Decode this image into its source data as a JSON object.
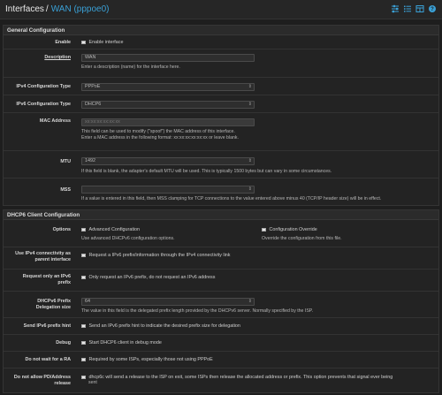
{
  "header": {
    "crumb_root": "Interfaces",
    "separator": "/",
    "crumb_current": "WAN (pppoe0)",
    "icons": [
      "sliders-icon",
      "list-icon",
      "table-icon",
      "help-icon"
    ]
  },
  "general": {
    "title": "General Configuration",
    "enable": {
      "label": "Enable",
      "text": "Enable interface"
    },
    "description": {
      "label": "Description",
      "value": "WAN",
      "help": "Enter a description (name) for the interface here."
    },
    "ipv4_type": {
      "label": "IPv4 Configuration Type",
      "value": "PPPoE"
    },
    "ipv6_type": {
      "label": "IPv6 Configuration Type",
      "value": "DHCP6"
    },
    "mac": {
      "label": "MAC Address",
      "placeholder": "xx:xx:xx:xx:xx:xx",
      "help1": "This field can be used to modify (\"spoof\") the MAC address of this interface.",
      "help2": "Enter a MAC address in the following format: xx:xx:xx:xx:xx:xx or leave blank."
    },
    "mtu": {
      "label": "MTU",
      "value": "1492",
      "help": "If this field is blank, the adapter's default MTU will be used. This is typically 1500 bytes but can vary in some circumstances."
    },
    "mss": {
      "label": "MSS",
      "value": "",
      "help": "If a value is entered in this field, then MSS clamping for TCP connections to the value entered above minus 40 (TCP/IP header size) will be in effect."
    }
  },
  "dhcp6": {
    "title": "DHCP6 Client Configuration",
    "options": {
      "label": "Options",
      "advanced": "Advanced Configuration",
      "advanced_help": "Use advanced DHCPv6 configuration options.",
      "override": "Configuration Override",
      "override_help": "Override the configuration from this file."
    },
    "ipv4_parent": {
      "label1": "Use IPv4 connectivity as",
      "label2": "parent interface",
      "text": "Request a IPv6 prefix/information through the IPv4 connectivity link"
    },
    "prefix_only": {
      "label1": "Request only an IPv6",
      "label2": "prefix",
      "text": "Only request an IPv6 prefix, do not request an IPv6 address"
    },
    "prefix_size": {
      "label1": "DHCPv6 Prefix",
      "label2": "Delegation size",
      "value": "64",
      "help": "The value in this field is the delegated prefix length provided by the DHCPv6 server. Normally specified by the ISP."
    },
    "prefix_hint": {
      "label": "Send IPv6 prefix hint",
      "text": "Send an IPv6 prefix hint to indicate the desired prefix size for delegation"
    },
    "debug": {
      "label": "Debug",
      "text": "Start DHCP6 client in debug mode"
    },
    "no_wait_ra": {
      "label": "Do not wait for a RA",
      "text": "Required by some ISPs, especially those not using PPPoE"
    },
    "no_release": {
      "label1": "Do not allow PD/Address",
      "label2": "release",
      "text1": "dhcp6c will send a release to the ISP on exit, some ISPs then release the allocated address or prefix. This option prevents that signal ever being",
      "text2": "sent"
    }
  }
}
